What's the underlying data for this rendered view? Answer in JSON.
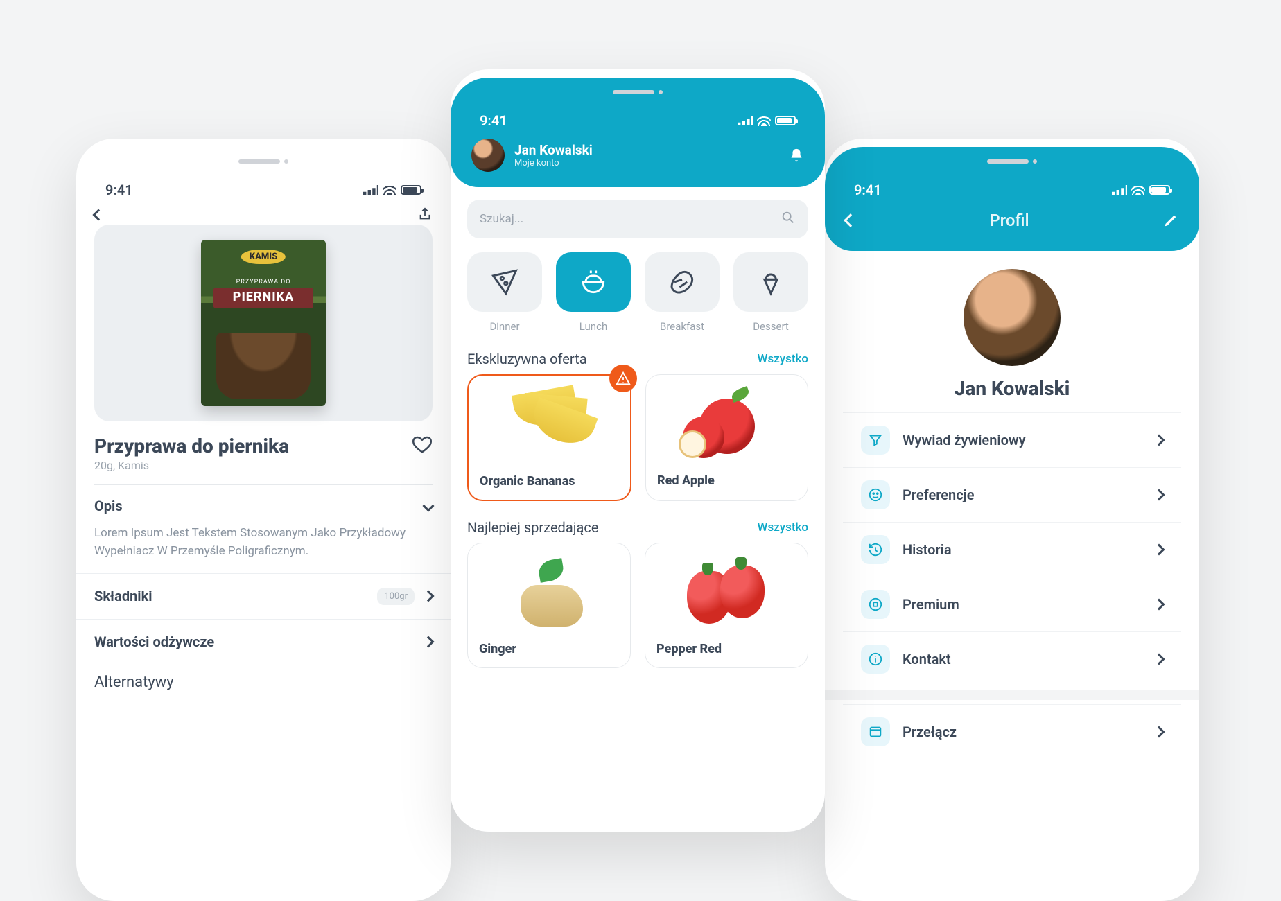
{
  "status_time": "9:41",
  "left": {
    "product_image_label": "KAMIS",
    "product_image_pretitle": "PRZYPRAWA DO",
    "product_image_title": "PIERNIKA",
    "title": "Przyprawa do piernika",
    "subtitle": "20g, Kamis",
    "section_opis": "Opis",
    "opis_text": "Lorem Ipsum Jest Tekstem Stosowanym Jako Przykładowy Wypełniacz W Przemyśle Poligraficznym.",
    "section_skladniki": "Składniki",
    "skladniki_pill": "100gr",
    "section_wartosci": "Wartości odżywcze",
    "section_alternatywy": "Alternatywy"
  },
  "mid": {
    "user_name": "Jan Kowalski",
    "user_sub": "Moje konto",
    "search_placeholder": "Szukaj...",
    "categories": [
      {
        "label": "Dinner"
      },
      {
        "label": "Lunch"
      },
      {
        "label": "Breakfast"
      },
      {
        "label": "Dessert"
      }
    ],
    "sec1_title": "Ekskluzywna oferta",
    "sec_more": "Wszystko",
    "sec1_items": [
      {
        "name": "Organic Bananas"
      },
      {
        "name": "Red Apple"
      }
    ],
    "sec2_title": "Najlepiej sprzedające",
    "sec2_items": [
      {
        "name": "Ginger"
      },
      {
        "name": "Pepper Red"
      }
    ]
  },
  "right": {
    "header_title": "Profil",
    "name": "Jan Kowalski",
    "menu": [
      {
        "label": "Wywiad żywieniowy"
      },
      {
        "label": "Preferencje"
      },
      {
        "label": "Historia"
      },
      {
        "label": "Premium"
      },
      {
        "label": "Kontakt"
      }
    ],
    "extra_item": "Przełącz"
  }
}
